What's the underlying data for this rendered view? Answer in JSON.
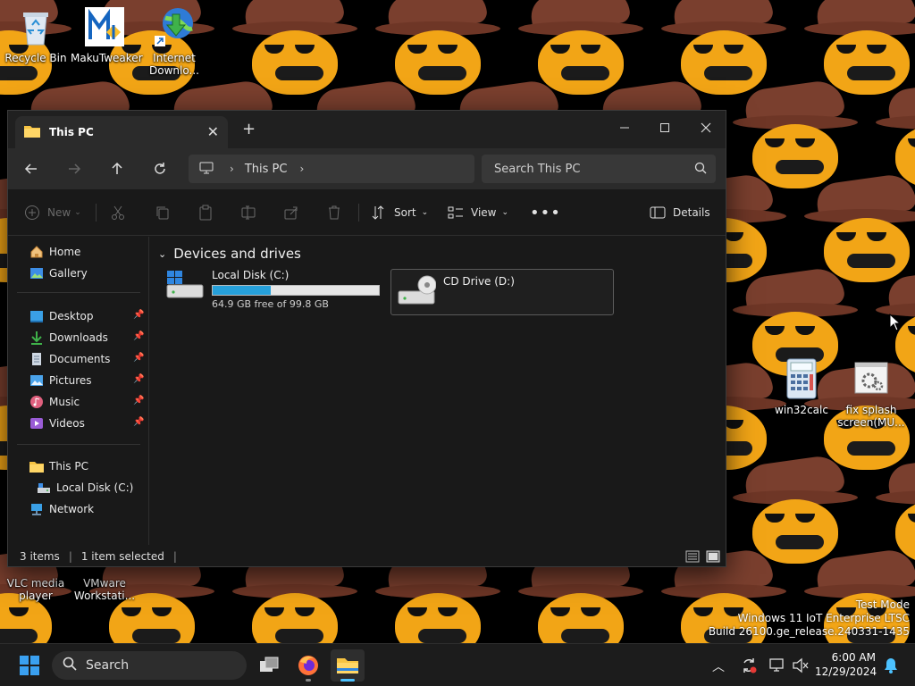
{
  "desktop": {
    "icons": [
      {
        "label": "Recycle Bin"
      },
      {
        "label": "MakuTweaker"
      },
      {
        "label": "Internet Downlo..."
      },
      {
        "label": "win32calc"
      },
      {
        "label": "fix splash screen(MU..."
      },
      {
        "label": "VLC media player"
      },
      {
        "label": "VMware Workstati..."
      }
    ],
    "watermark": {
      "line1": "Test Mode",
      "line2": "Windows 11 IoT Enterprise LTSC",
      "line3": "Build 26100.ge_release.240331-1435"
    }
  },
  "explorer": {
    "tab_title": "This PC",
    "address": {
      "segment": "This PC"
    },
    "search": {
      "placeholder": "Search This PC"
    },
    "commands": {
      "new": "New",
      "sort": "Sort",
      "view": "View",
      "details": "Details"
    },
    "nav": {
      "home": "Home",
      "gallery": "Gallery",
      "desktop": "Desktop",
      "downloads": "Downloads",
      "documents": "Documents",
      "pictures": "Pictures",
      "music": "Music",
      "videos": "Videos",
      "this_pc": "This PC",
      "local_disk": "Local Disk (C:)",
      "network": "Network"
    },
    "group_header": "Devices and drives",
    "drives": [
      {
        "name": "Local Disk (C:)",
        "free_text": "64.9 GB free of 99.8 GB",
        "used_fraction": 0.35
      },
      {
        "name": "CD Drive (D:)"
      }
    ],
    "status": {
      "items": "3 items",
      "selected": "1 item selected"
    }
  },
  "taskbar": {
    "search_label": "Search",
    "clock": {
      "time": "6:00 AM",
      "date": "12/29/2024"
    }
  },
  "colors": {
    "accent": "#26a0da",
    "window_bg": "#191919",
    "duck_yellow": "#f2a516",
    "duck_hat": "#7a3f2e"
  }
}
